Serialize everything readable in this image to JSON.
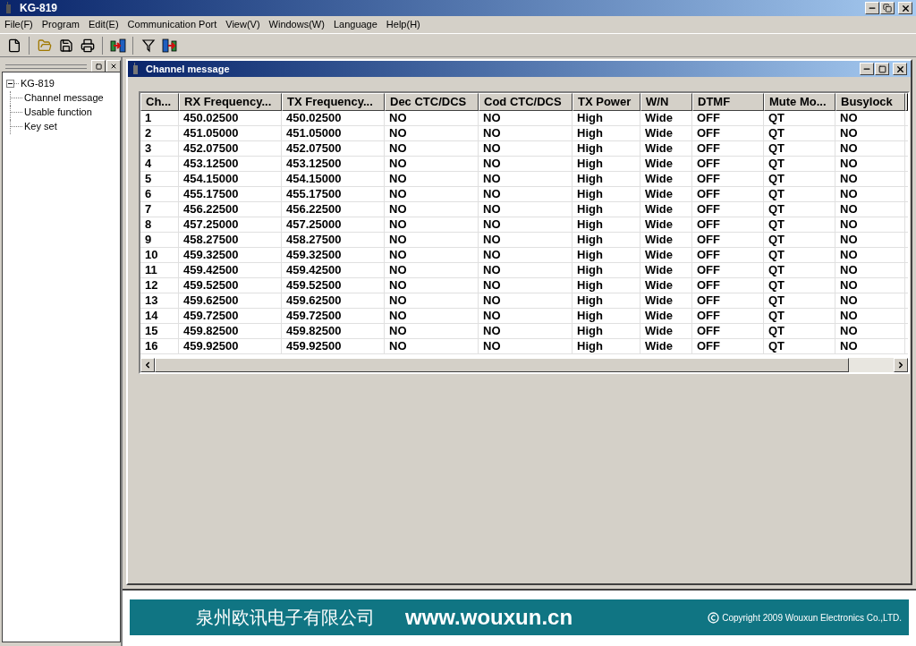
{
  "window": {
    "title": "KG-819"
  },
  "menu": [
    "File(F)",
    "Program",
    "Edit(E)",
    "Communication Port",
    "View(V)",
    "Windows(W)",
    "Language",
    "Help(H)"
  ],
  "tree": {
    "label": "KG-819",
    "expanded": true,
    "children": [
      {
        "label": "Channel message"
      },
      {
        "label": "Usable function"
      },
      {
        "label": "Key set"
      }
    ]
  },
  "child_window": {
    "title": "Channel message"
  },
  "table": {
    "columns": [
      "Ch...",
      "RX Frequency...",
      "TX Frequency...",
      "Dec CTC/DCS",
      "Cod CTC/DCS",
      "TX Power",
      "W/N",
      "DTMF",
      "Mute Mo...",
      "Busylock"
    ],
    "rows": [
      [
        "1",
        "450.02500",
        "450.02500",
        "NO",
        "NO",
        "High",
        "Wide",
        "OFF",
        "QT",
        "NO"
      ],
      [
        "2",
        "451.05000",
        "451.05000",
        "NO",
        "NO",
        "High",
        "Wide",
        "OFF",
        "QT",
        "NO"
      ],
      [
        "3",
        "452.07500",
        "452.07500",
        "NO",
        "NO",
        "High",
        "Wide",
        "OFF",
        "QT",
        "NO"
      ],
      [
        "4",
        "453.12500",
        "453.12500",
        "NO",
        "NO",
        "High",
        "Wide",
        "OFF",
        "QT",
        "NO"
      ],
      [
        "5",
        "454.15000",
        "454.15000",
        "NO",
        "NO",
        "High",
        "Wide",
        "OFF",
        "QT",
        "NO"
      ],
      [
        "6",
        "455.17500",
        "455.17500",
        "NO",
        "NO",
        "High",
        "Wide",
        "OFF",
        "QT",
        "NO"
      ],
      [
        "7",
        "456.22500",
        "456.22500",
        "NO",
        "NO",
        "High",
        "Wide",
        "OFF",
        "QT",
        "NO"
      ],
      [
        "8",
        "457.25000",
        "457.25000",
        "NO",
        "NO",
        "High",
        "Wide",
        "OFF",
        "QT",
        "NO"
      ],
      [
        "9",
        "458.27500",
        "458.27500",
        "NO",
        "NO",
        "High",
        "Wide",
        "OFF",
        "QT",
        "NO"
      ],
      [
        "10",
        "459.32500",
        "459.32500",
        "NO",
        "NO",
        "High",
        "Wide",
        "OFF",
        "QT",
        "NO"
      ],
      [
        "11",
        "459.42500",
        "459.42500",
        "NO",
        "NO",
        "High",
        "Wide",
        "OFF",
        "QT",
        "NO"
      ],
      [
        "12",
        "459.52500",
        "459.52500",
        "NO",
        "NO",
        "High",
        "Wide",
        "OFF",
        "QT",
        "NO"
      ],
      [
        "13",
        "459.62500",
        "459.62500",
        "NO",
        "NO",
        "High",
        "Wide",
        "OFF",
        "QT",
        "NO"
      ],
      [
        "14",
        "459.72500",
        "459.72500",
        "NO",
        "NO",
        "High",
        "Wide",
        "OFF",
        "QT",
        "NO"
      ],
      [
        "15",
        "459.82500",
        "459.82500",
        "NO",
        "NO",
        "High",
        "Wide",
        "OFF",
        "QT",
        "NO"
      ],
      [
        "16",
        "459.92500",
        "459.92500",
        "NO",
        "NO",
        "High",
        "Wide",
        "OFF",
        "QT",
        "NO"
      ]
    ]
  },
  "banner": {
    "company": "泉州欧讯电子有限公司",
    "url": "www.wouxun.cn",
    "copyright": "Copyright 2009 Wouxun Electronics Co.,LTD."
  }
}
